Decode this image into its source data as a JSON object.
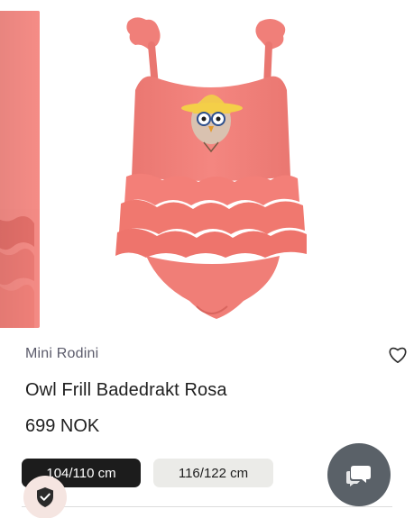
{
  "product": {
    "brand": "Mini Rodini",
    "name": "Owl Frill Badedrakt Rosa",
    "price": "699 NOK"
  },
  "sizes": [
    {
      "label": "104/110 cm",
      "selected": true
    },
    {
      "label": "116/122 cm",
      "selected": false
    }
  ],
  "icons": {
    "wishlist": "heart-outline-icon",
    "chat": "chat-bubbles-icon",
    "trust": "shield-check-icon"
  },
  "colors": {
    "swimsuit": "#f2857e",
    "selected_size_bg": "#1c1c1c",
    "size_bg": "#ebebe8",
    "chat_bg": "#5a6168",
    "badge_bg": "#f5e5e1",
    "brand_text": "#5b5b6b"
  }
}
